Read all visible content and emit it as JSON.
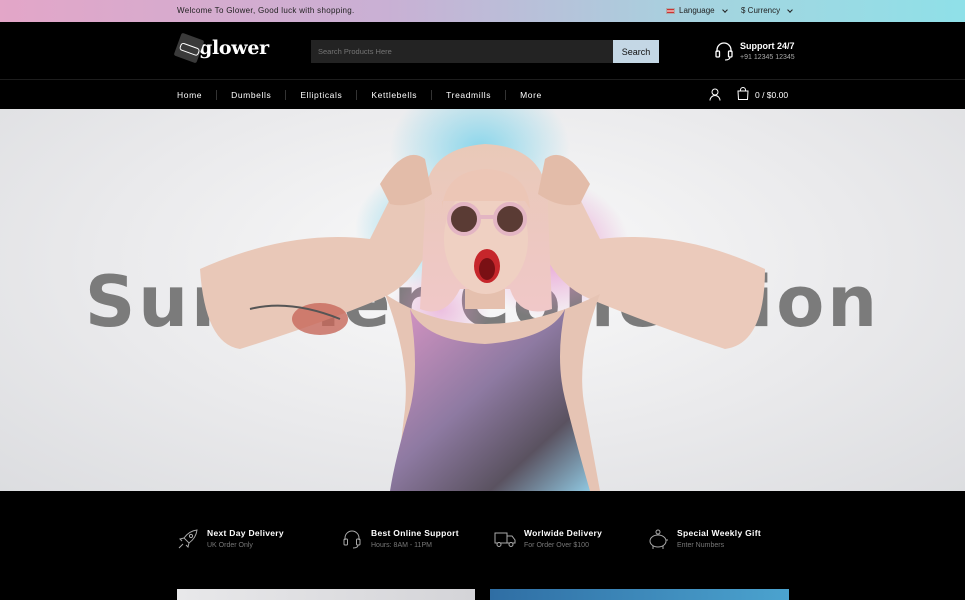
{
  "topbar": {
    "welcome": "Welcome To Glower, Good luck with shopping.",
    "language": "Language",
    "currency": "$ Currency"
  },
  "header": {
    "logo_text": "glower",
    "search_placeholder": "Search Products Here",
    "search_button": "Search",
    "support_title": "Support 24/7",
    "support_phone": "+91 12345 12345"
  },
  "nav": {
    "items": [
      "Home",
      "Dumbells",
      "Ellipticals",
      "Kettlebells",
      "Treadmills",
      "More"
    ],
    "cart": "0 / $0.00"
  },
  "hero": {
    "headline": "Summer Collection"
  },
  "features": [
    {
      "title": "Next Day Delivery",
      "subtitle": "UK Order Only",
      "icon": "rocket-icon"
    },
    {
      "title": "Best Online Support",
      "subtitle": "Hours: 8AM - 11PM",
      "icon": "headset-icon"
    },
    {
      "title": "Worlwide Delivery",
      "subtitle": "For Order Over $100",
      "icon": "truck-icon"
    },
    {
      "title": "Special Weekly Gift",
      "subtitle": "Enter Numbers",
      "icon": "piggy-bank-icon"
    }
  ],
  "colors": {
    "topbar_gradient_start": "#e3a6c8",
    "topbar_gradient_end": "#8fe0e8",
    "search_button_bg": "#c4d7e5",
    "background": "#000000"
  }
}
